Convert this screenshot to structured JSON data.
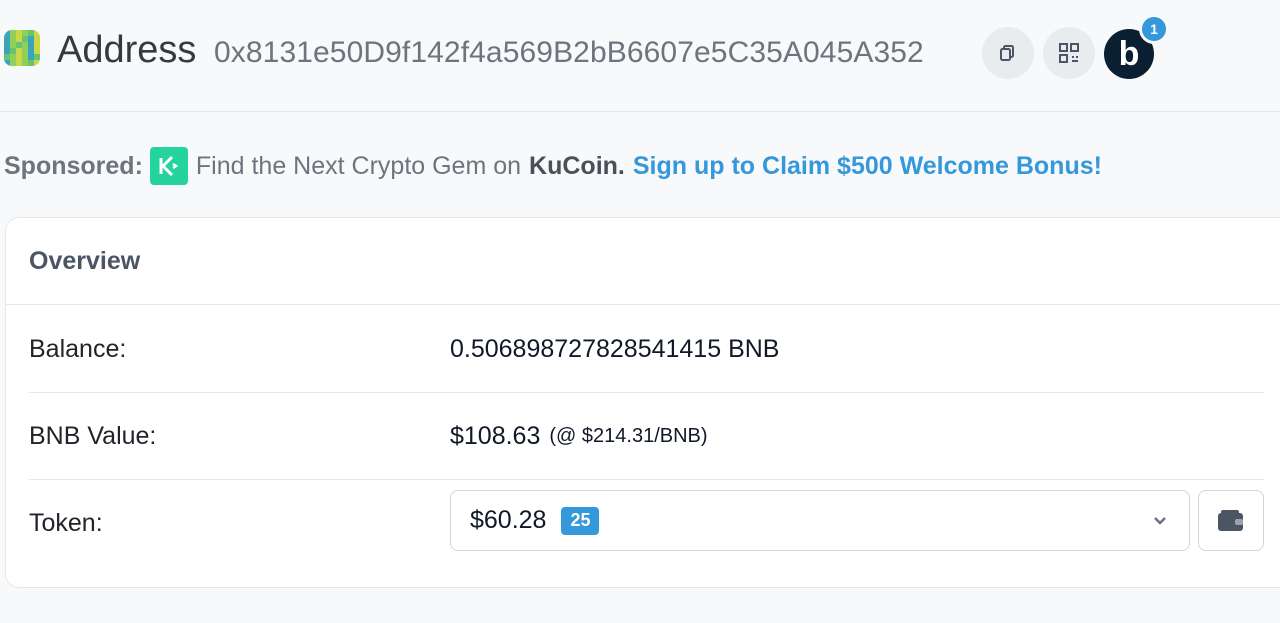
{
  "header": {
    "title": "Address",
    "address": "0x8131e50D9f142f4a569B2bB6607e5C35A045A352",
    "avatar_letter": "b",
    "notification_count": "1",
    "icons": [
      "copy-icon",
      "qr-code-icon",
      "avatar-icon"
    ]
  },
  "sponsored": {
    "label": "Sponsored:",
    "text_before": "Find the Next Crypto Gem on",
    "brand": "KuCoin.",
    "cta": "Sign up to Claim $500 Welcome Bonus!",
    "logo_icon": "kucoin-logo-icon"
  },
  "overview": {
    "title": "Overview",
    "balance": {
      "label": "Balance:",
      "value": "0.506898727828541415 BNB"
    },
    "bnb_value": {
      "label": "BNB Value:",
      "value": "$108.63",
      "subvalue": "(@ $214.31/BNB)"
    },
    "token": {
      "label": "Token:",
      "value": "$60.28",
      "count": "25"
    }
  },
  "colors": {
    "accent": "#3498db",
    "background": "#f8f9fa",
    "card": "#ffffff",
    "kucoin": "#25d39d"
  }
}
